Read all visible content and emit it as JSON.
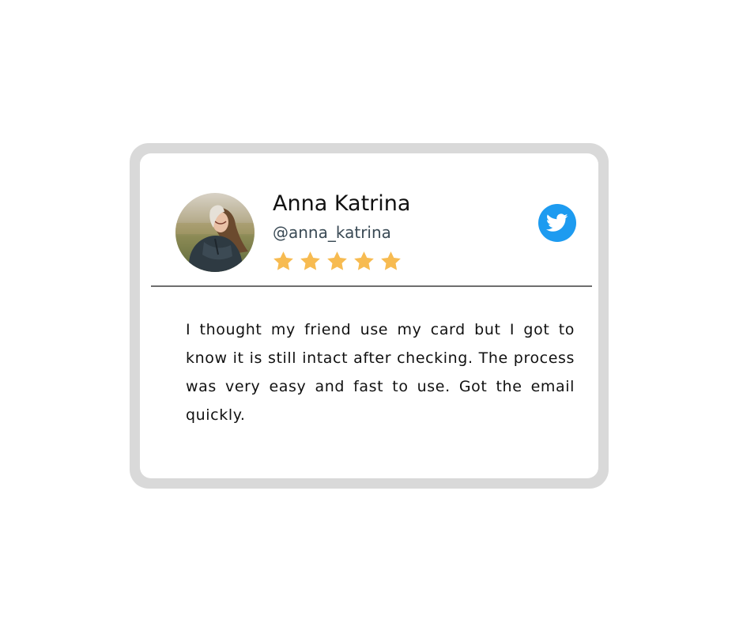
{
  "review": {
    "user": {
      "name": "Anna Katrina",
      "handle": "@anna_katrina",
      "avatar": "profile-photo"
    },
    "rating": {
      "stars": 5,
      "max": 5,
      "color": "#f7bb51"
    },
    "platform": {
      "name": "twitter",
      "icon": "twitter-bird-icon",
      "color": "#1d9bf0"
    },
    "text": "I thought my friend use my card but I got to know it is still intact after checking. The process was very easy and fast to use. Got the email quickly."
  },
  "colors": {
    "frame": "#d9d9d9",
    "card": "#ffffff",
    "divider": "#6e6e6e"
  }
}
